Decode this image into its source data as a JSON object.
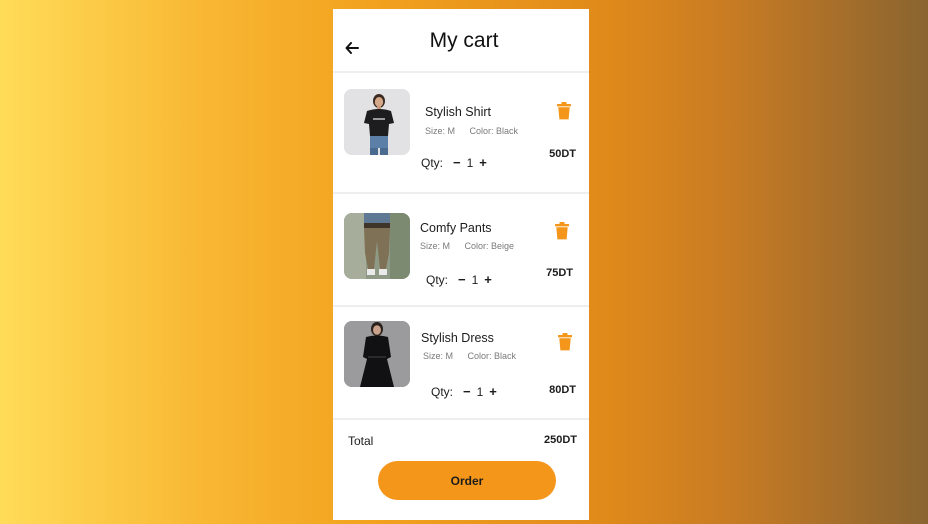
{
  "header": {
    "title": "My cart",
    "back_icon": "arrow-left-icon"
  },
  "accent_color": "#f4961a",
  "cart": {
    "items": [
      {
        "name": "Stylish Shirt",
        "size": "Size: M",
        "color": "Color: Black",
        "qty_label": "Qty:",
        "minus": "−",
        "qty": "1",
        "plus": "+",
        "price": "50DT",
        "delete_icon": "trash-icon"
      },
      {
        "name": "Comfy Pants",
        "size": "Size: M",
        "color": "Color: Beige",
        "qty_label": "Qty:",
        "minus": "−",
        "qty": "1",
        "plus": "+",
        "price": "75DT",
        "delete_icon": "trash-icon"
      },
      {
        "name": "Stylish Dress",
        "size": "Size: M",
        "color": "Color: Black",
        "qty_label": "Qty:",
        "minus": "−",
        "qty": "1",
        "plus": "+",
        "price": "80DT",
        "delete_icon": "trash-icon"
      }
    ]
  },
  "summary": {
    "total_label": "Total",
    "total_value": "250DT"
  },
  "order_button": {
    "label": "Order"
  }
}
